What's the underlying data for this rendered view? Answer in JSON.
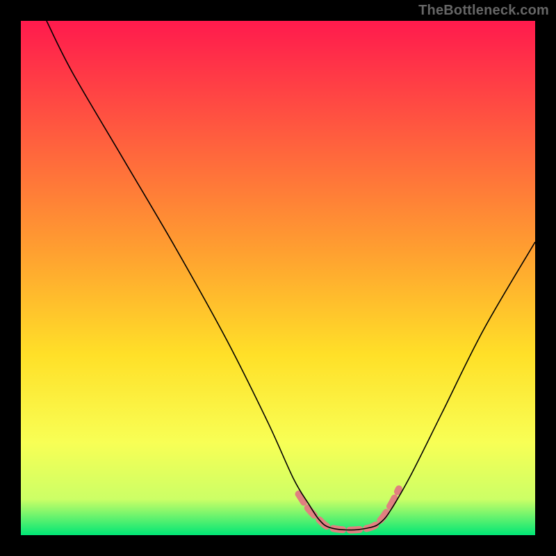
{
  "attribution": "TheBottleneck.com",
  "chart_data": {
    "type": "line",
    "title": "",
    "xlabel": "",
    "ylabel": "",
    "xlim": [
      0,
      100
    ],
    "ylim": [
      0,
      100
    ],
    "background_gradient": {
      "stops": [
        {
          "offset": 0.0,
          "color": "#ff1a4d"
        },
        {
          "offset": 0.45,
          "color": "#ffa030"
        },
        {
          "offset": 0.65,
          "color": "#ffe028"
        },
        {
          "offset": 0.82,
          "color": "#f8ff55"
        },
        {
          "offset": 0.93,
          "color": "#ccff66"
        },
        {
          "offset": 1.0,
          "color": "#00e676"
        }
      ]
    },
    "curve": {
      "color": "#000000",
      "width": 1.6,
      "points": [
        {
          "x": 5,
          "y": 100
        },
        {
          "x": 10,
          "y": 90
        },
        {
          "x": 20,
          "y": 73
        },
        {
          "x": 30,
          "y": 56
        },
        {
          "x": 40,
          "y": 38
        },
        {
          "x": 48,
          "y": 22
        },
        {
          "x": 53,
          "y": 11
        },
        {
          "x": 56,
          "y": 6
        },
        {
          "x": 58,
          "y": 3
        },
        {
          "x": 60,
          "y": 1.5
        },
        {
          "x": 64,
          "y": 1.0
        },
        {
          "x": 68,
          "y": 1.5
        },
        {
          "x": 70,
          "y": 2.5
        },
        {
          "x": 72,
          "y": 5
        },
        {
          "x": 76,
          "y": 12
        },
        {
          "x": 82,
          "y": 24
        },
        {
          "x": 90,
          "y": 40
        },
        {
          "x": 100,
          "y": 57
        }
      ]
    },
    "highlight": {
      "color": "#e08080",
      "width": 10,
      "cap": "round",
      "dash": "14 10",
      "points": [
        {
          "x": 54,
          "y": 8
        },
        {
          "x": 56,
          "y": 5
        },
        {
          "x": 58,
          "y": 3
        },
        {
          "x": 60,
          "y": 1.5
        },
        {
          "x": 64,
          "y": 1.0
        },
        {
          "x": 68,
          "y": 1.5
        },
        {
          "x": 70,
          "y": 3
        },
        {
          "x": 72,
          "y": 6
        },
        {
          "x": 73.5,
          "y": 9
        }
      ]
    }
  }
}
